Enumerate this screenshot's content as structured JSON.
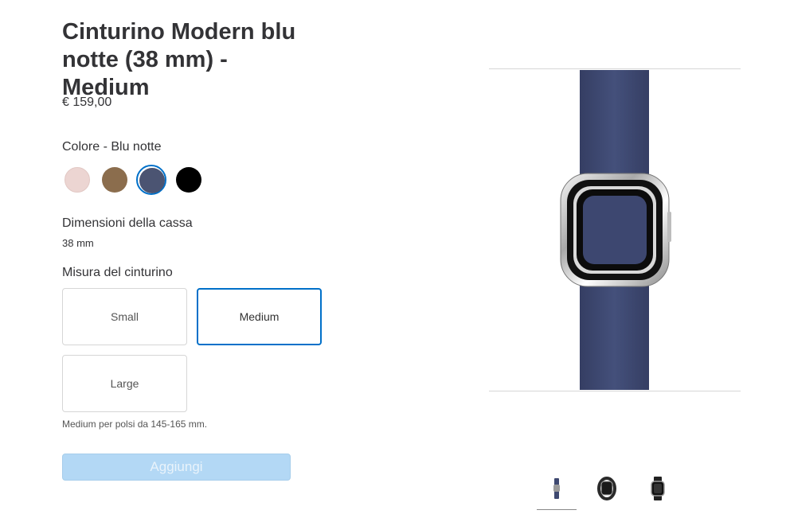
{
  "product": {
    "title": "Cinturino Modern blu notte (38 mm) - Medium",
    "price": "€ 159,00"
  },
  "color": {
    "label": "Colore - Blu notte",
    "swatches": [
      {
        "name": "Rosa",
        "hex": "#ecd5d2",
        "selected": false
      },
      {
        "name": "Marrone",
        "hex": "#8b6d4d",
        "selected": false
      },
      {
        "name": "Blu notte",
        "hex": "#4b5472",
        "selected": true
      },
      {
        "name": "Nero",
        "hex": "#000000",
        "selected": false
      }
    ]
  },
  "case_size": {
    "label": "Dimensioni della cassa",
    "value": "38 mm"
  },
  "band_size": {
    "label": "Misura del cinturino",
    "options": [
      "Small",
      "Medium",
      "Large"
    ],
    "selected": "Medium",
    "hint": "Medium per polsi da 145-165 mm."
  },
  "add_button": {
    "label": "Aggiungi",
    "enabled": false
  },
  "gallery": {
    "thumbnails": [
      {
        "icon": "band-side-icon",
        "active": true
      },
      {
        "icon": "watch-side-icon",
        "active": false
      },
      {
        "icon": "watch-front-icon",
        "active": false
      }
    ],
    "band_color": "#3e4870"
  },
  "colors": {
    "accent": "#0070c9",
    "button_disabled": "#b3d8f5"
  }
}
